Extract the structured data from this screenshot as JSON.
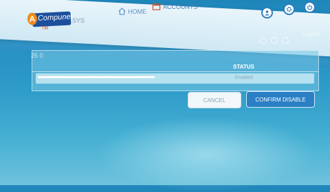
{
  "header": {
    "logo_mark": "A",
    "logo_text": "Compunet",
    "logo_sub": "TM",
    "logo_tail": "SYS"
  },
  "nav": {
    "home_label": "HOME",
    "accounts_label": "ACCOUNTS"
  },
  "toolbar": {
    "ghost_left": "",
    "ghost_right": "Logout"
  },
  "page": {
    "label": "25 0"
  },
  "status_panel": {
    "column_header": "STATUS",
    "row_value": "Enabled"
  },
  "actions": {
    "cancel_label": "CANCEL",
    "confirm_label": "CONFIRM DISABLE"
  },
  "colors": {
    "background_top": "#1f86ba",
    "header": "#e9f5fb",
    "logo": "#1c4f9c",
    "accent": "#2a7fc5"
  }
}
